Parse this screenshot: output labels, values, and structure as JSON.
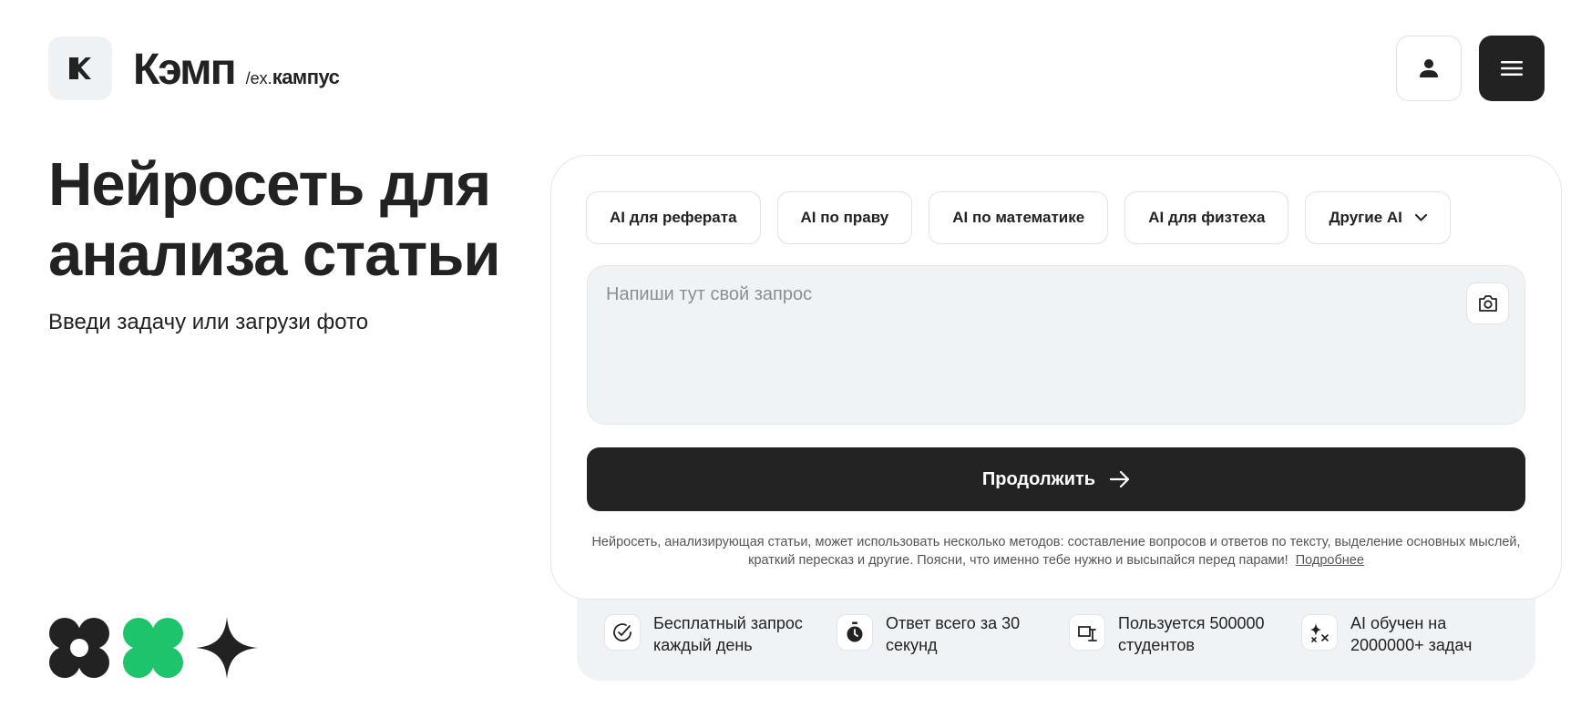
{
  "header": {
    "brand_name": "Кэмп",
    "brand_ex": "/ex.",
    "brand_old": "кампус"
  },
  "hero": {
    "title": "Нейросеть для анализа статьи",
    "subtitle": "Введи задачу или загрузи фото"
  },
  "card": {
    "chips": [
      {
        "label": "AI для реферата"
      },
      {
        "label": "AI по праву"
      },
      {
        "label": "AI по математике"
      },
      {
        "label": "AI для физтеха"
      },
      {
        "label": "Другие AI"
      }
    ],
    "query": {
      "placeholder": "Напиши тут свой запрос",
      "value": ""
    },
    "submit_label": "Продолжить",
    "note_text": "Нейросеть, анализирующая статьи, может использовать несколько методов: составление вопросов и ответов по тексту, выделение основных мыслей, краткий пересказ и другие. Поясни, что именно тебе нужно и высыпайся перед парами!",
    "note_link": "Подробнее"
  },
  "features": [
    {
      "icon": "check-circle-icon",
      "text": "Бесплатный запрос каждый день"
    },
    {
      "icon": "stopwatch-icon",
      "text": "Ответ всего за 30 секунд"
    },
    {
      "icon": "students-icon",
      "text": "Пользуется 500000 студентов"
    },
    {
      "icon": "sparkles-icon",
      "text": "AI обучен на 2000000+ задач"
    }
  ],
  "colors": {
    "dark": "#222222",
    "green": "#1ec46b",
    "surface": "#f0f3f6",
    "border": "#dfe3e8"
  }
}
